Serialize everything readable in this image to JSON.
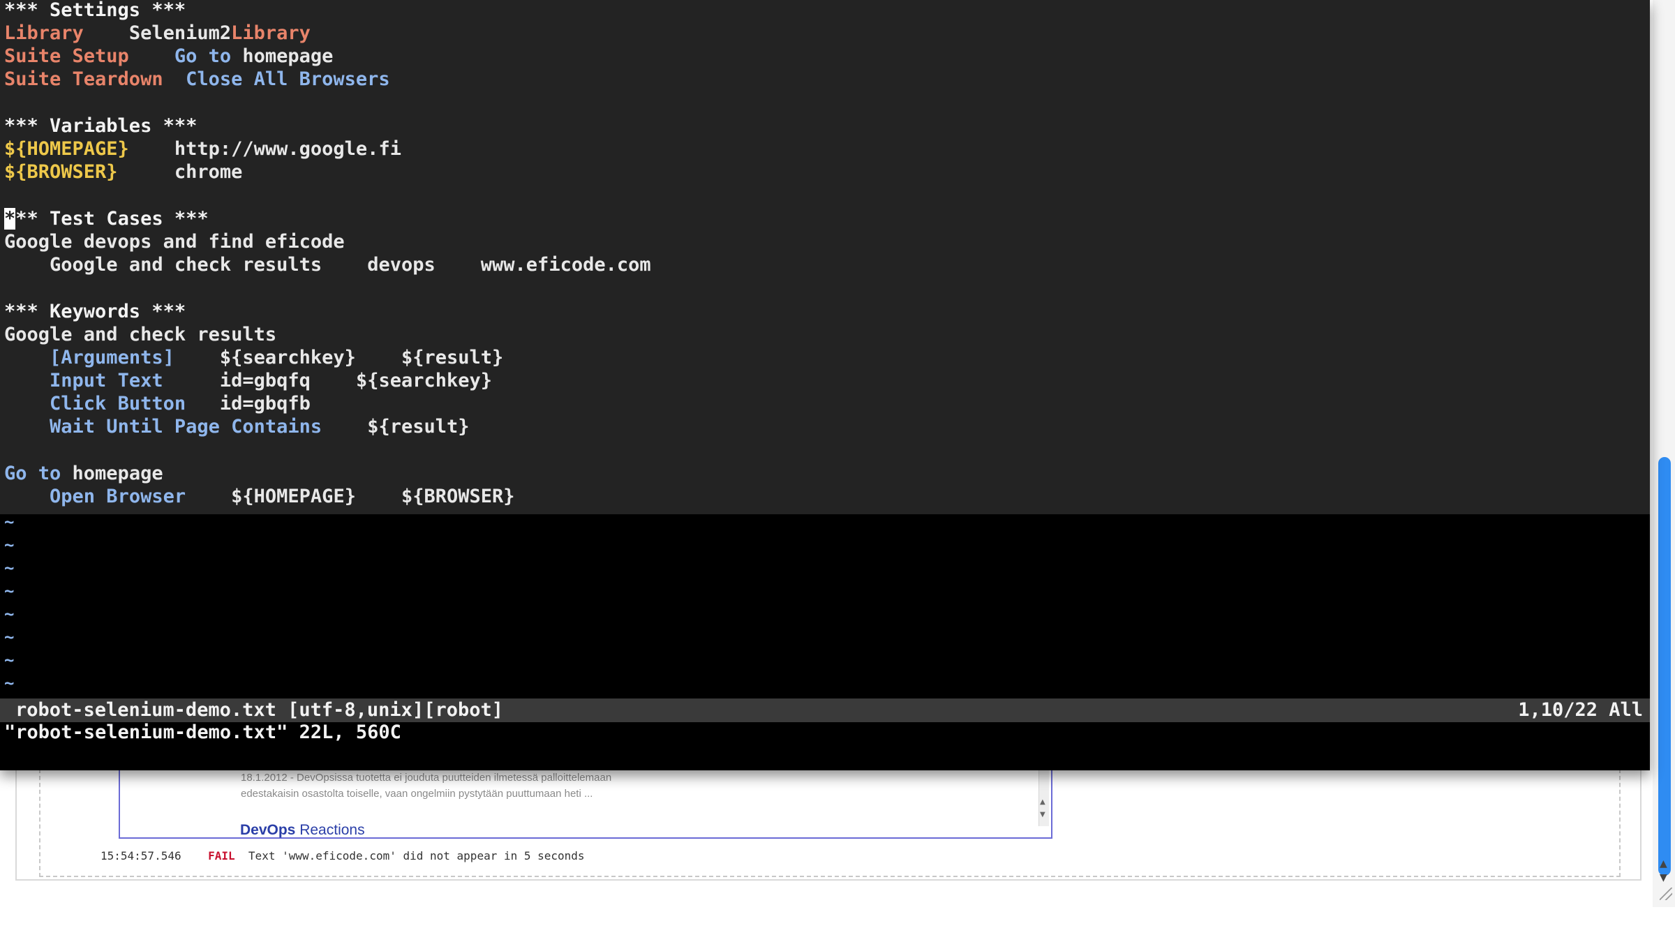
{
  "colors": {
    "editor_bg": "#232323",
    "section_header": "#f3f3f3",
    "setting_name": "#e8846a",
    "keyword": "#8fb6ec",
    "variable": "#eec84a",
    "fail": "#c8102e",
    "link": "#2b3fa8",
    "scrollbar_thumb": "#2f8cf2"
  },
  "editor": {
    "lines": {
      "settings_header": "*** Settings ***",
      "library_label": "Library",
      "library_value_prefix": "Selenium2",
      "library_value_suffix": "Library",
      "suite_setup_label": "Suite Setup",
      "suite_setup_value_kw": "Go to",
      "suite_setup_value_rest": " homepage",
      "suite_teardown_label": "Suite Teardown",
      "suite_teardown_value": "Close All Browsers",
      "variables_header": "*** Variables ***",
      "homepage_var": "${HOMEPAGE}",
      "homepage_value": "http://www.google.fi",
      "browser_var": "${BROWSER}",
      "browser_value": "chrome",
      "test_cases_cursor_char": "*",
      "test_cases_header_rest": "** Test Cases ***",
      "test_case_name": "Google devops and find eficode",
      "test_step_kw": "Google and check results",
      "test_step_arg1": "devops",
      "test_step_arg2": "www.eficode.com",
      "keywords_header": "*** Keywords ***",
      "keyword1_name": "Google and check results",
      "arguments_label": "[Arguments]",
      "arg_searchkey": "${searchkey}",
      "arg_result": "${result}",
      "input_text_kw": "Input Text",
      "input_text_locator": "id=gbqfq",
      "input_text_value": "${searchkey}",
      "click_button_kw": "Click Button",
      "click_button_locator": "id=gbqfb",
      "wait_kw": "Wait Until Page Contains",
      "wait_value": "${result}",
      "keyword2_name_kw": "Go to",
      "keyword2_name_rest": " homepage",
      "open_browser_kw": "Open Browser",
      "open_browser_arg1": "${HOMEPAGE}",
      "open_browser_arg2": "${BROWSER}"
    },
    "empty_line_marker": "~",
    "status_line": {
      "file": "robot-selenium-demo.txt [utf-8,unix][robot]",
      "position": "1,10/22 All"
    },
    "command_line": "\"robot-selenium-demo.txt\" 22L, 560C"
  },
  "browser": {
    "snippet_line1": "18.1.2012 - DevOpsissa tuotetta ei jouduta puutteiden ilmetessä palloittelemaan",
    "snippet_line2": "edestakaisin osastolta toiselle, vaan ongelmiin pystytään puuttumaan heti ...",
    "link_bold": "DevOps",
    "link_rest": " Reactions",
    "log": {
      "timestamp": "15:54:57.546",
      "level": "FAIL",
      "message": "Text 'www.eficode.com' did not appear in 5 seconds"
    }
  }
}
